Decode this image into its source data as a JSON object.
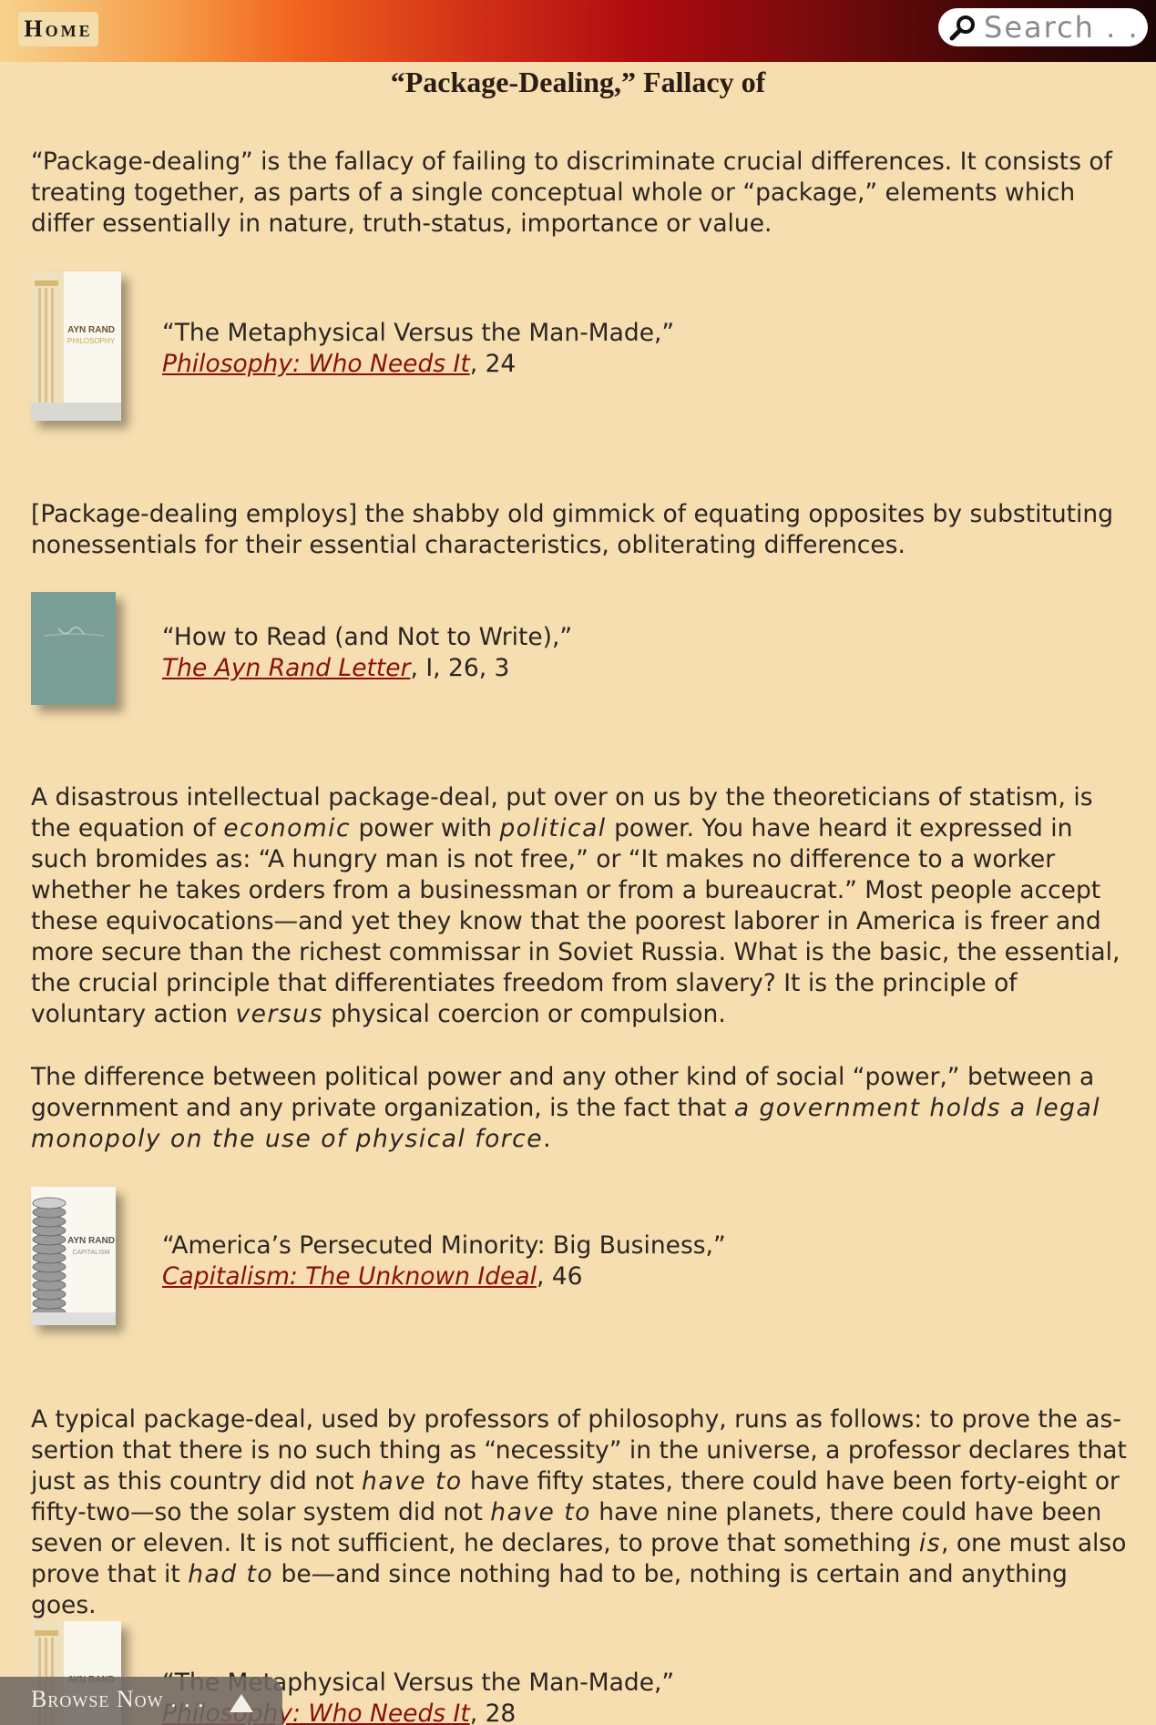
{
  "header": {
    "home_label": "Home",
    "search_placeholder": "Search . . ."
  },
  "page": {
    "title": "“Package-Dealing,” Fallacy of"
  },
  "entries": [
    {
      "quote": [
        "“Package-dealing” is the fallacy of failing to discriminate crucial differences. It consists of treating together, as parts of a single conceptual whole or “package,” elements which differ essentially in nature, truth-status, importance or value."
      ],
      "essay": "“The Metaphysical Versus the Man-Made,”",
      "book": "Philosophy: Who Needs It",
      "ref": ", 24"
    },
    {
      "quote": [
        "[Package-dealing employs] the shabby old gimmick of equating opposites by substituting nonessentials for their essential characteristics, obliterating differences."
      ],
      "essay": "“How to Read (and Not to Write),”",
      "book": "The Ayn Rand Letter",
      "ref": ", I, 26, 3"
    },
    {
      "quote": [
        "A disastrous intellectual package-deal, put over on us by the theoreticians of statism, is the equation of ",
        "economic",
        " power with ",
        "political",
        " power. You have heard it expressed in such bromides as: “A hungry man is not free,” or “It makes no difference to a worker whether he takes orders from a businessman or from a bureaucrat.” Most people accept these equivo­cations—and yet they know that the poorest laborer in America is freer and more secure than the richest commissar in Soviet Russia. What is the basic, the essential, the crucial principle that differentiates freedom from slavery? It is the principle of voluntary action ",
        "versus",
        " physical coercion or compulsion.",
        "The difference between political power and any other kind of social “power,” between a government and any private organization, is the fact that ",
        "a government holds a legal monopoly on the use of physical force",
        "."
      ],
      "essay": "“America’s Persecuted Minority: Big Business,”",
      "book": "Capitalism: The Unknown Ideal",
      "ref": ", 46"
    },
    {
      "quote": [
        "A typical package-deal, used by professors of philosophy, runs as follows: to prove the as­sertion that there is no such thing as “necessity” in the universe, a professor declares that just as this country did not ",
        "have to",
        " have fifty states, there could have been forty-eight or fifty-two—so the solar system did not ",
        "have to",
        " have nine planets, there could have been seven or eleven. It is not sufficient, he declares, to prove that something ",
        "is",
        ", one must also prove that it ",
        "had to",
        " be—and since nothing had to be, nothing is certain and anything goes."
      ],
      "essay": "“The Metaphysical Versus the Man-Made,”",
      "book": "Philosophy: Who Needs It",
      "ref": ", 28"
    }
  ],
  "covers": {
    "philosophy": {
      "author": "AYN RAND",
      "subtitle": "PHILOSOPHY",
      "color": "#faf7ee",
      "accent": "#c9a24a"
    },
    "letter": {
      "color": "#7a9e95"
    },
    "capitalism": {
      "author": "AYN RAND",
      "subtitle": "CAPITALISM",
      "color": "#faf7ee",
      "accent": "#8e8e8e"
    }
  },
  "footer": {
    "browse_label": "Browse Now . . ."
  }
}
